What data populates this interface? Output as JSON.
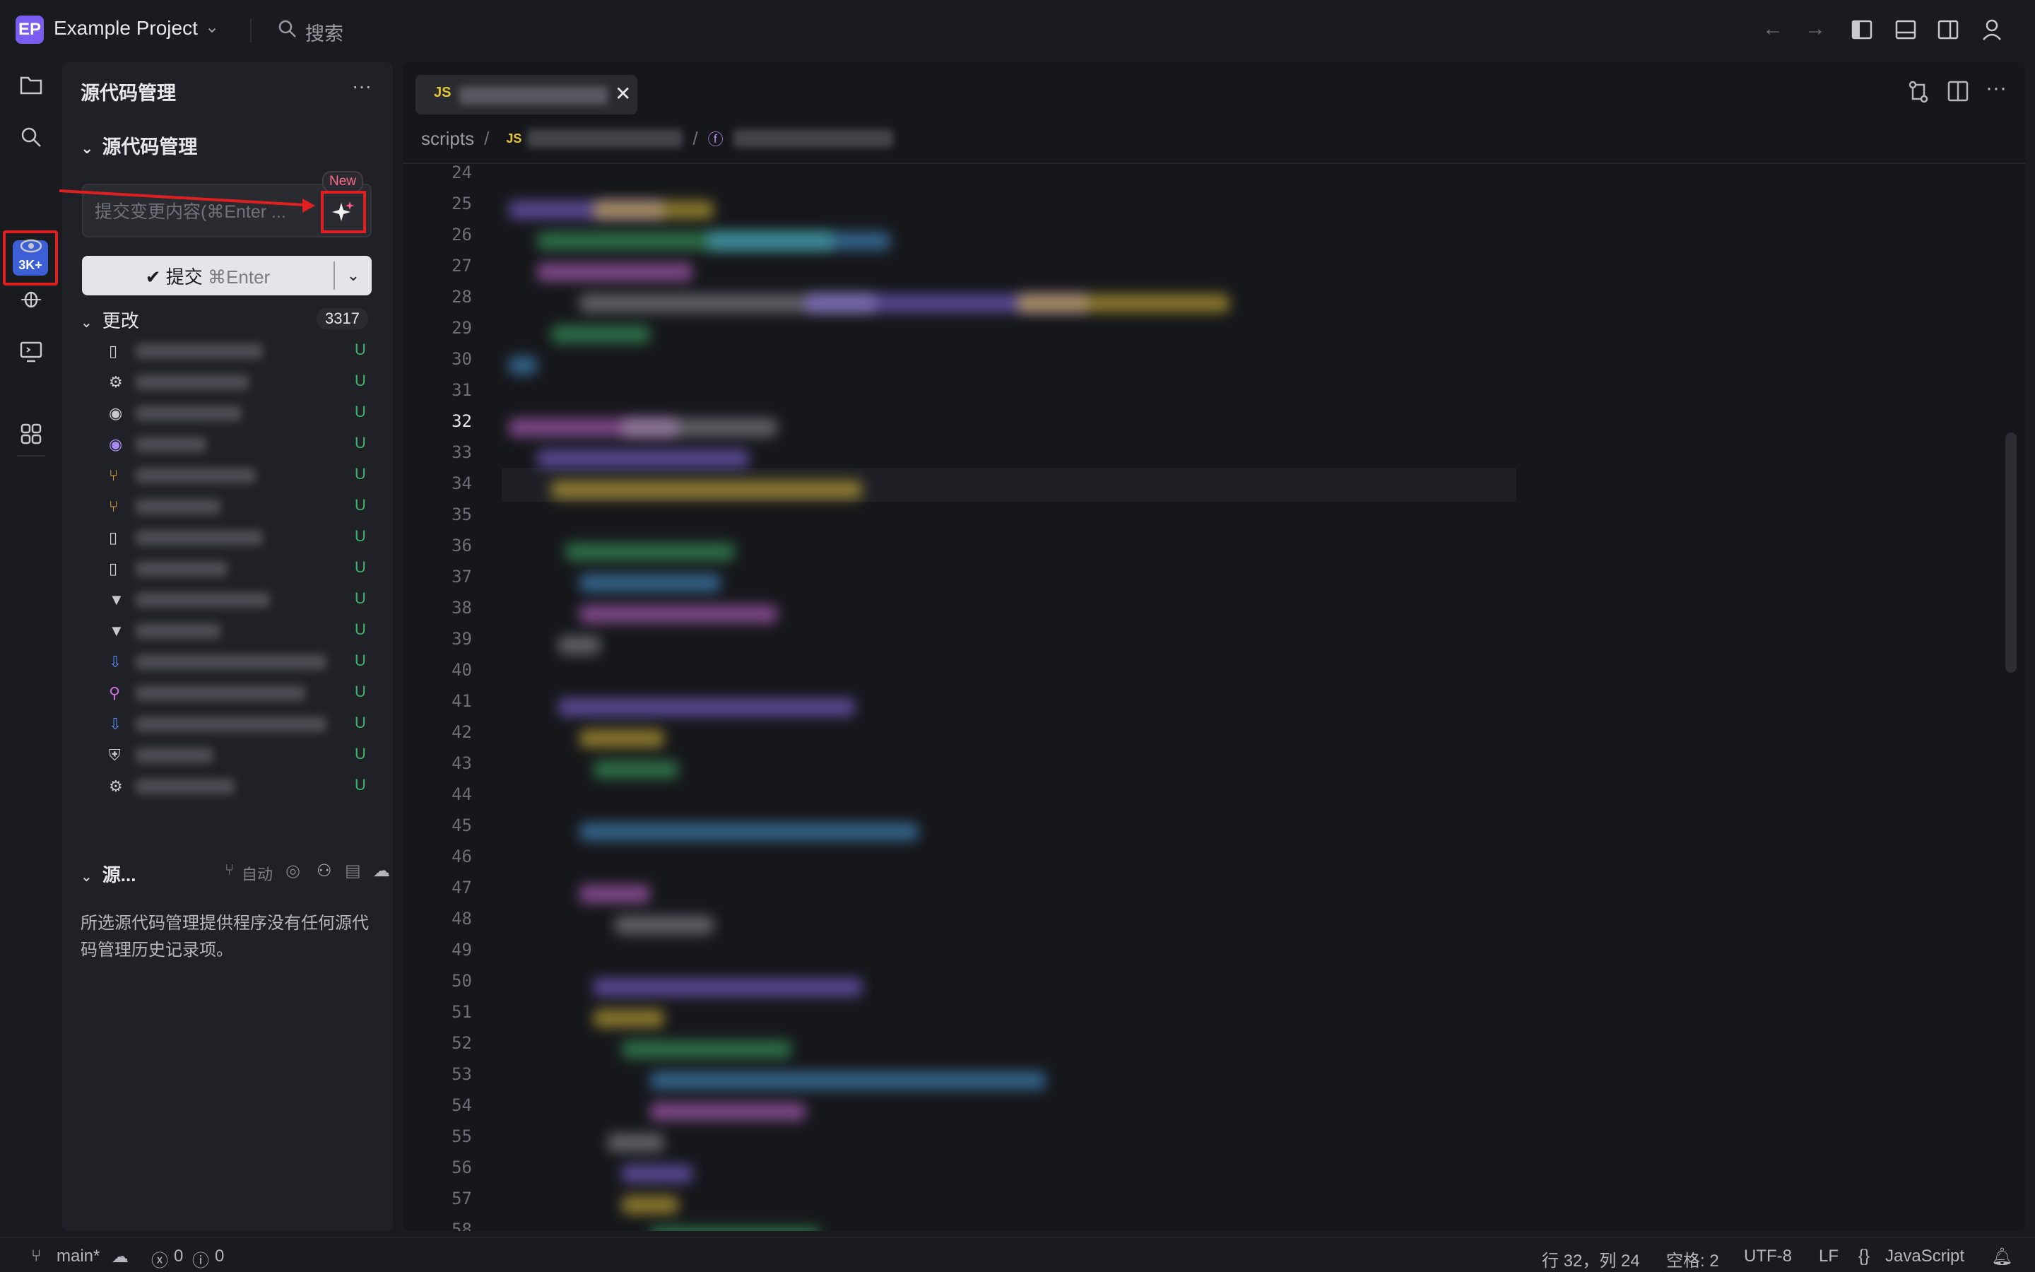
{
  "titlebar": {
    "project_badge": "EP",
    "project_name": "Example Project",
    "search_label": "搜索",
    "icons": [
      "back-arrow-icon",
      "forward-arrow-icon",
      "toggle-primary-sidebar-icon",
      "toggle-panel-icon",
      "toggle-secondary-sidebar-icon",
      "account-icon"
    ]
  },
  "activity_bar": {
    "badge_text": "3K+",
    "items": [
      "explorer-icon",
      "search-icon",
      "source-control-icon",
      "remote-icon",
      "debug-icon",
      "remote-explorer-icon",
      "extensions-icon"
    ]
  },
  "scm": {
    "title": "源代码管理",
    "section_title": "源代码管理",
    "commit_placeholder": "提交变更内容(⌘Enter ...",
    "new_tag": "New",
    "commit_button": "提交",
    "commit_shortcut": "⌘Enter",
    "changes_label": "更改",
    "changes_count": "3317",
    "status_letter": "U",
    "history_title": "源...",
    "history_auto": "自动",
    "history_message": "所选源代码管理提供程序没有任何源代码管理历史记录项。"
  },
  "editor": {
    "tab_lang": "JS",
    "breadcrumb_root": "scripts",
    "breadcrumb_lang": "JS",
    "line_numbers": [
      "24",
      "25",
      "26",
      "27",
      "28",
      "29",
      "30",
      "31",
      "32",
      "33",
      "34",
      "35",
      "36",
      "37",
      "38",
      "39",
      "40",
      "41",
      "42",
      "43",
      "44",
      "45",
      "46",
      "47",
      "48",
      "49",
      "50",
      "51",
      "52",
      "53",
      "54",
      "55",
      "56",
      "57",
      "58"
    ],
    "current_line": "32"
  },
  "statusbar": {
    "branch": "main*",
    "errors": "0",
    "warnings": "0",
    "position": "行 32，列 24",
    "spaces": "空格: 2",
    "encoding": "UTF-8",
    "eol": "LF",
    "language": "JavaScript"
  },
  "colors": {
    "accent": "#7b5cf0",
    "badge_blue": "#3d5fd6",
    "annotation_red": "#e02020",
    "untracked_green": "#3fb36a"
  }
}
